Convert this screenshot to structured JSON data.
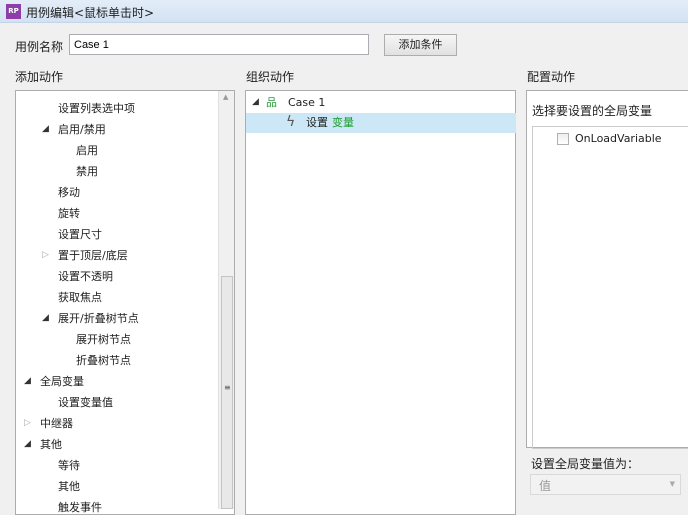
{
  "window": {
    "title": "用例编辑<鼠标单击时>",
    "logo": "RP"
  },
  "case_name": {
    "label": "用例名称",
    "value": "Case 1"
  },
  "add_condition_label": "添加条件",
  "add_actions": {
    "header": "添加动作",
    "items": [
      {
        "label": "设置列表选中项",
        "level": 2,
        "state": "none"
      },
      {
        "label": "启用/禁用",
        "level": 2,
        "state": "expanded"
      },
      {
        "label": "启用",
        "level": 3,
        "state": "none"
      },
      {
        "label": "禁用",
        "level": 3,
        "state": "none"
      },
      {
        "label": "移动",
        "level": 2,
        "state": "none"
      },
      {
        "label": "旋转",
        "level": 2,
        "state": "none"
      },
      {
        "label": "设置尺寸",
        "level": 2,
        "state": "none"
      },
      {
        "label": "置于顶层/底层",
        "level": 2,
        "state": "collapsed"
      },
      {
        "label": "设置不透明",
        "level": 2,
        "state": "none"
      },
      {
        "label": "获取焦点",
        "level": 2,
        "state": "none"
      },
      {
        "label": "展开/折叠树节点",
        "level": 2,
        "state": "expanded"
      },
      {
        "label": "展开树节点",
        "level": 3,
        "state": "none"
      },
      {
        "label": "折叠树节点",
        "level": 3,
        "state": "none"
      },
      {
        "label": "全局变量",
        "level": 1,
        "state": "expanded"
      },
      {
        "label": "设置变量值",
        "level": 2,
        "state": "none"
      },
      {
        "label": "中继器",
        "level": 1,
        "state": "collapsed"
      },
      {
        "label": "其他",
        "level": 1,
        "state": "expanded"
      },
      {
        "label": "等待",
        "level": 2,
        "state": "none"
      },
      {
        "label": "其他",
        "level": 2,
        "state": "none"
      },
      {
        "label": "触发事件",
        "level": 2,
        "state": "none"
      }
    ]
  },
  "organize": {
    "header": "组织动作",
    "case_label": "Case 1",
    "action_prefix": "设置",
    "action_target": "变量"
  },
  "configure": {
    "header": "配置动作",
    "select_label": "选择要设置的全局变量",
    "variables": [
      "OnLoadVariable"
    ],
    "set_value_label": "设置全局变量值为：",
    "value_type": "值"
  },
  "colors": {
    "selection": "#cce8f6",
    "target_green": "#1a9b2c"
  }
}
